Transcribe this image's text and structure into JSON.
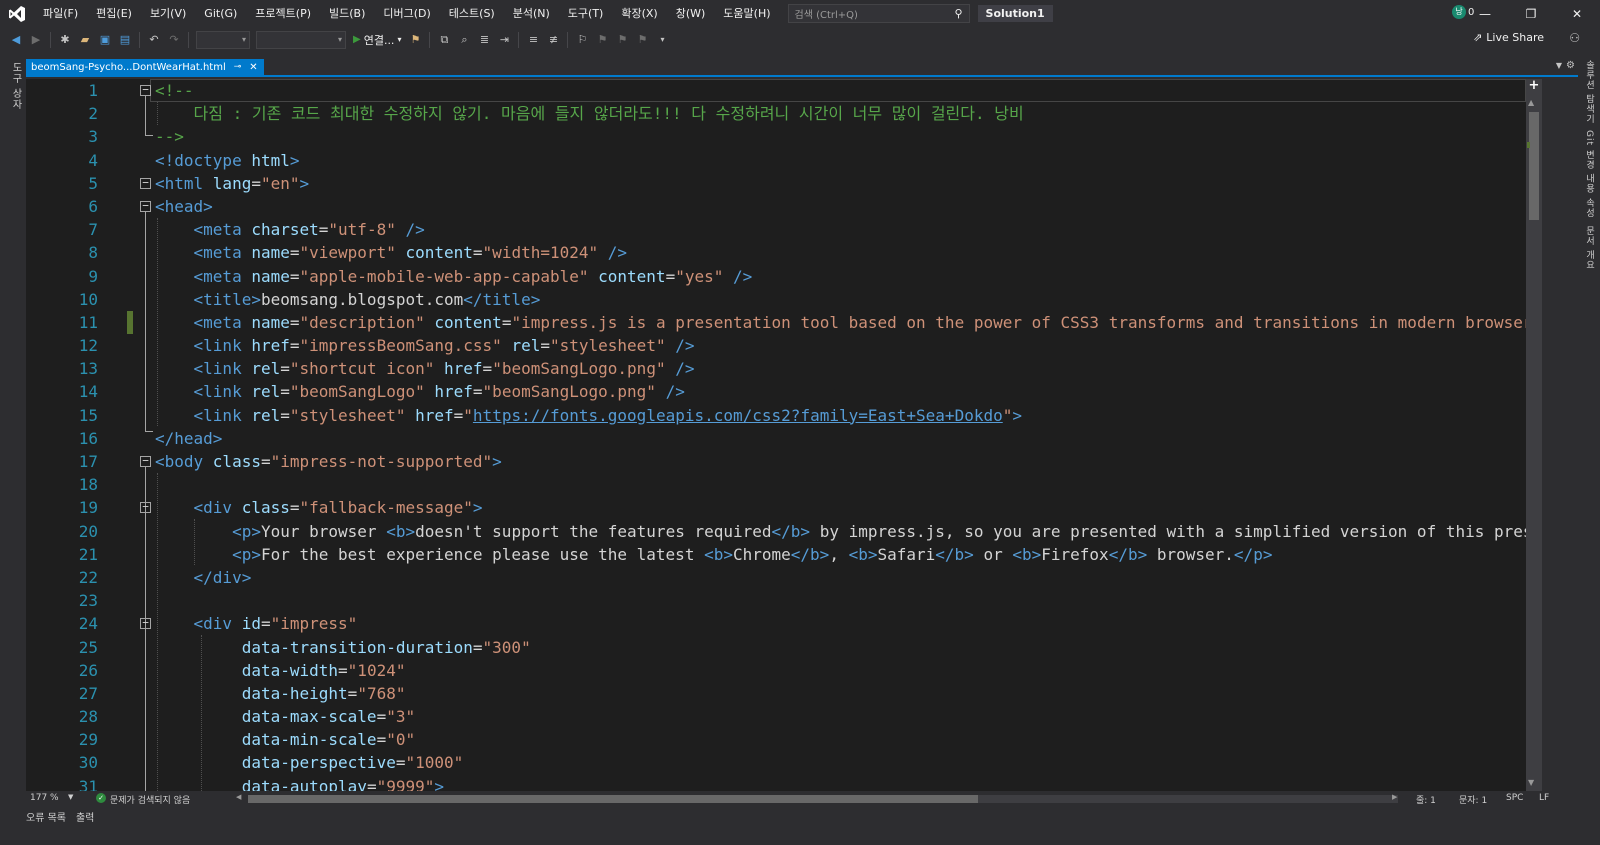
{
  "menu": [
    "파일(F)",
    "편집(E)",
    "보기(V)",
    "Git(G)",
    "프로젝트(P)",
    "빌드(B)",
    "디버그(D)",
    "테스트(S)",
    "분석(N)",
    "도구(T)",
    "확장(X)",
    "창(W)",
    "도움말(H)"
  ],
  "search": {
    "placeholder": "검색 (Ctrl+Q)"
  },
  "solution_title": "Solution1",
  "user": {
    "initial": "낭",
    "count": "0"
  },
  "toolbar": {
    "run_label": "연결...",
    "live_share": "Live Share"
  },
  "left_strip": {
    "toolbox": "도구 상자"
  },
  "right_strip": [
    "솔루션 탐색기",
    "Git 변경 내용",
    "속성",
    "문서 개요"
  ],
  "tab": {
    "title": "beomSang-Psycho...DontWearHat.html",
    "pin": "⊸",
    "close": "✕"
  },
  "editor": {
    "lines": [
      {
        "n": "1",
        "html": "<span class='c-com'>&lt;!--</span>"
      },
      {
        "n": "2",
        "html": "<span class='c-com'>    다짐 : 기존 코드 최대한 수정하지 않기. 마음에 들지 않더라도!!! 다 수정하려니 시간이 너무 많이 걸린다. 낭비</span>"
      },
      {
        "n": "3",
        "html": "<span class='c-com'>--&gt;</span>"
      },
      {
        "n": "4",
        "html": "<span class='c-tag'>&lt;!doctype </span><span class='c-attr'>html</span><span class='c-tag'>&gt;</span>"
      },
      {
        "n": "5",
        "html": "<span class='c-tag'>&lt;html </span><span class='c-attr'>lang</span><span class='c-txt'>=</span><span class='c-str'>\"en\"</span><span class='c-tag'>&gt;</span>"
      },
      {
        "n": "6",
        "html": "<span class='c-tag'>&lt;head&gt;</span>"
      },
      {
        "n": "7",
        "html": "    <span class='c-tag'>&lt;meta </span><span class='c-attr'>charset</span><span class='c-txt'>=</span><span class='c-str'>\"utf-8\"</span><span class='c-tag'> /&gt;</span>"
      },
      {
        "n": "8",
        "html": "    <span class='c-tag'>&lt;meta </span><span class='c-attr'>name</span><span class='c-txt'>=</span><span class='c-str'>\"viewport\"</span> <span class='c-attr'>content</span><span class='c-txt'>=</span><span class='c-str'>\"width=1024\"</span><span class='c-tag'> /&gt;</span>"
      },
      {
        "n": "9",
        "html": "    <span class='c-tag'>&lt;meta </span><span class='c-attr'>name</span><span class='c-txt'>=</span><span class='c-str'>\"apple-mobile-web-app-capable\"</span> <span class='c-attr'>content</span><span class='c-txt'>=</span><span class='c-str'>\"yes\"</span><span class='c-tag'> /&gt;</span>"
      },
      {
        "n": "10",
        "html": "    <span class='c-tag'>&lt;title&gt;</span><span class='c-txt'>beomsang.blogspot.com</span><span class='c-tag'>&lt;/title&gt;</span>"
      },
      {
        "n": "11",
        "html": "    <span class='c-tag'>&lt;meta </span><span class='c-attr'>name</span><span class='c-txt'>=</span><span class='c-str'>\"description\"</span> <span class='c-attr'>content</span><span class='c-txt'>=</span><span class='c-str'>\"impress.js is a presentation tool based on the power of CSS3 transforms and transitions in modern browsers a</span>",
        "changed": true
      },
      {
        "n": "12",
        "html": "    <span class='c-tag'>&lt;link </span><span class='c-attr'>href</span><span class='c-txt'>=</span><span class='c-str'>\"impressBeomSang.css\"</span> <span class='c-attr'>rel</span><span class='c-txt'>=</span><span class='c-str'>\"stylesheet\"</span><span class='c-tag'> /&gt;</span>"
      },
      {
        "n": "13",
        "html": "    <span class='c-tag'>&lt;link </span><span class='c-attr'>rel</span><span class='c-txt'>=</span><span class='c-str'>\"shortcut icon\"</span> <span class='c-attr'>href</span><span class='c-txt'>=</span><span class='c-str'>\"beomSangLogo.png\"</span><span class='c-tag'> /&gt;</span>"
      },
      {
        "n": "14",
        "html": "    <span class='c-tag'>&lt;link </span><span class='c-attr'>rel</span><span class='c-txt'>=</span><span class='c-str'>\"beomSangLogo\"</span> <span class='c-attr'>href</span><span class='c-txt'>=</span><span class='c-str'>\"beomSangLogo.png\"</span><span class='c-tag'> /&gt;</span>"
      },
      {
        "n": "15",
        "html": "    <span class='c-tag'>&lt;link </span><span class='c-attr'>rel</span><span class='c-txt'>=</span><span class='c-str'>\"stylesheet\"</span> <span class='c-attr'>href</span><span class='c-txt'>=</span><span class='c-str'>\"</span><span class='c-link'>https://fonts.googleapis.com/css2?family=East+Sea+Dokdo</span><span class='c-str'>\"</span><span class='c-tag'>&gt;</span>"
      },
      {
        "n": "16",
        "html": "<span class='c-tag'>&lt;/head&gt;</span>"
      },
      {
        "n": "17",
        "html": "<span class='c-tag'>&lt;body </span><span class='c-attr'>class</span><span class='c-txt'>=</span><span class='c-str'>\"impress-not-supported\"</span><span class='c-tag'>&gt;</span>"
      },
      {
        "n": "18",
        "html": ""
      },
      {
        "n": "19",
        "html": "    <span class='c-tag'>&lt;div </span><span class='c-attr'>class</span><span class='c-txt'>=</span><span class='c-str'>\"fallback-message\"</span><span class='c-tag'>&gt;</span>"
      },
      {
        "n": "20",
        "html": "        <span class='c-tag'>&lt;p&gt;</span><span class='c-txt'>Your browser </span><span class='c-tag'>&lt;b&gt;</span><span class='c-txt'>doesn't support the features required</span><span class='c-tag'>&lt;/b&gt;</span><span class='c-txt'> by impress.js, so you are presented with a simplified version of this present</span>"
      },
      {
        "n": "21",
        "html": "        <span class='c-tag'>&lt;p&gt;</span><span class='c-txt'>For the best experience please use the latest </span><span class='c-tag'>&lt;b&gt;</span><span class='c-txt'>Chrome</span><span class='c-tag'>&lt;/b&gt;</span><span class='c-txt'>, </span><span class='c-tag'>&lt;b&gt;</span><span class='c-txt'>Safari</span><span class='c-tag'>&lt;/b&gt;</span><span class='c-txt'> or </span><span class='c-tag'>&lt;b&gt;</span><span class='c-txt'>Firefox</span><span class='c-tag'>&lt;/b&gt;</span><span class='c-txt'> browser.</span><span class='c-tag'>&lt;/p&gt;</span>"
      },
      {
        "n": "22",
        "html": "    <span class='c-tag'>&lt;/div&gt;</span>"
      },
      {
        "n": "23",
        "html": ""
      },
      {
        "n": "24",
        "html": "    <span class='c-tag'>&lt;div </span><span class='c-attr'>id</span><span class='c-txt'>=</span><span class='c-str'>\"impress\"</span>"
      },
      {
        "n": "25",
        "html": "         <span class='c-attr'>data-transition-duration</span><span class='c-txt'>=</span><span class='c-str'>\"300\"</span>"
      },
      {
        "n": "26",
        "html": "         <span class='c-attr'>data-width</span><span class='c-txt'>=</span><span class='c-str'>\"1024\"</span>"
      },
      {
        "n": "27",
        "html": "         <span class='c-attr'>data-height</span><span class='c-txt'>=</span><span class='c-str'>\"768\"</span>"
      },
      {
        "n": "28",
        "html": "         <span class='c-attr'>data-max-scale</span><span class='c-txt'>=</span><span class='c-str'>\"3\"</span>"
      },
      {
        "n": "29",
        "html": "         <span class='c-attr'>data-min-scale</span><span class='c-txt'>=</span><span class='c-str'>\"0\"</span>"
      },
      {
        "n": "30",
        "html": "         <span class='c-attr'>data-perspective</span><span class='c-txt'>=</span><span class='c-str'>\"1000\"</span>"
      },
      {
        "n": "31",
        "html": "         <span class='c-attr'>data-autoplay</span><span class='c-txt'>=</span><span class='c-str'>\"9999\"</span><span class='c-tag'>&gt;</span>"
      }
    ],
    "fold_lines": [
      "1",
      "5",
      "6",
      "17",
      "19",
      "24"
    ]
  },
  "status": {
    "zoom": "177 %",
    "issues": "문제가 검색되지 않음",
    "line": "줄: 1",
    "col": "문자: 1",
    "spc": "SPC",
    "lf": "LF"
  },
  "bottom_tabs": [
    "오류 목록",
    "출력"
  ]
}
